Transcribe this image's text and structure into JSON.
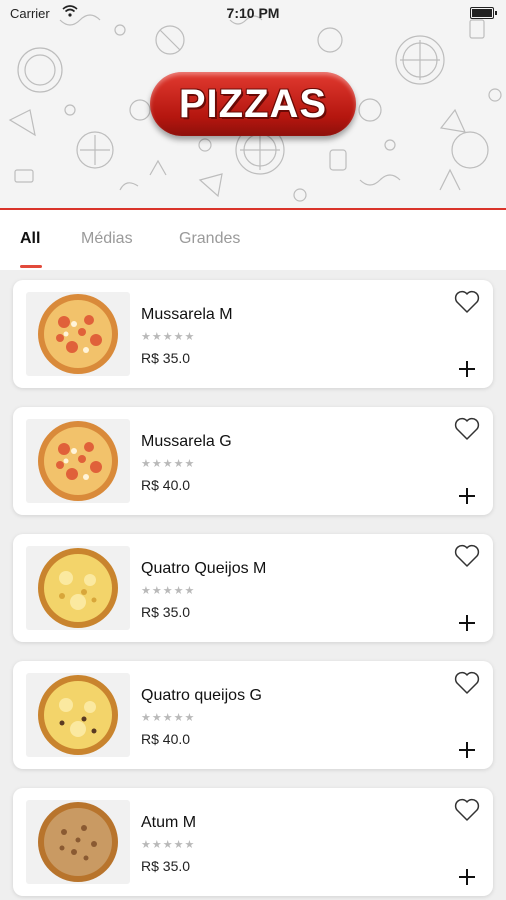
{
  "status_bar": {
    "carrier": "Carrier",
    "time": "7:10 PM"
  },
  "header": {
    "logo_text": "PIZZAS",
    "accent_color": "#d9332a"
  },
  "tabs": [
    {
      "label": "All",
      "active": true
    },
    {
      "label": "Médias",
      "active": false
    },
    {
      "label": "Grandes",
      "active": false
    }
  ],
  "products": [
    {
      "name": "Mussarela M",
      "rating": "★★★★★",
      "price": "R$ 35.0"
    },
    {
      "name": "Mussarela G",
      "rating": "★★★★★",
      "price": "R$ 40.0"
    },
    {
      "name": "Quatro Queijos M",
      "rating": "★★★★★",
      "price": "R$ 35.0"
    },
    {
      "name": "Quatro queijos G",
      "rating": "★★★★★",
      "price": "R$ 40.0"
    },
    {
      "name": "Atum M",
      "rating": "★★★★★",
      "price": "R$ 35.0"
    }
  ]
}
